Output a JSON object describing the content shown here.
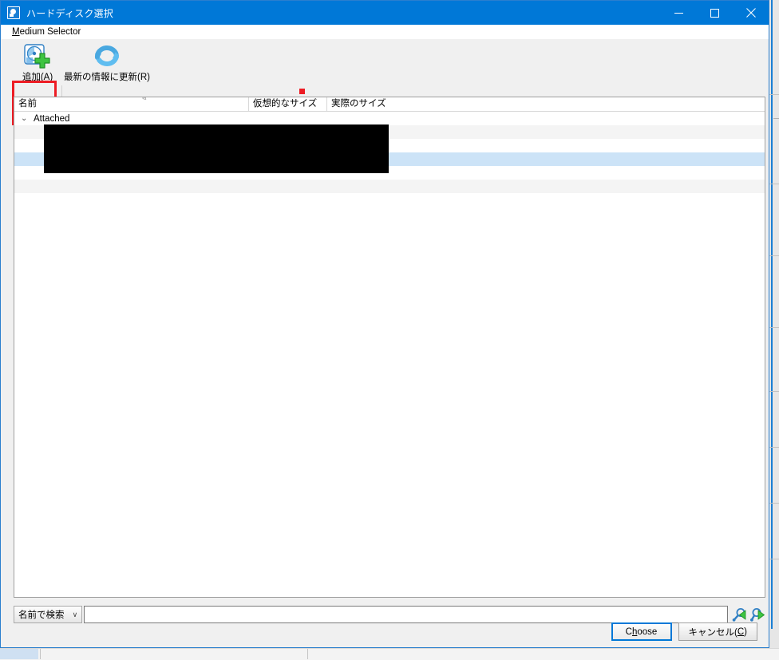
{
  "window": {
    "title": "ハードディスク選択",
    "icon": "harddisk-icon",
    "controls": {
      "minimize": "minimize-icon",
      "maximize": "maximize-icon",
      "close": "close-icon"
    }
  },
  "menubar": {
    "items": [
      {
        "label_prefix": "M",
        "label_rest": "edium Selector",
        "name": "medium-selector"
      }
    ]
  },
  "toolbar": {
    "add": {
      "label": "追加(A)",
      "icon": "harddisk-add-icon",
      "highlighted": true
    },
    "refresh": {
      "label": "最新の情報に更新(R)",
      "icon": "refresh-icon"
    },
    "highlight_color": "#ed1c24",
    "marker_color": "#ed1c24"
  },
  "listview": {
    "columns": [
      {
        "label": "名前",
        "name": "column-name",
        "sorted": true,
        "sort_indicator": "ⱏ"
      },
      {
        "label": "仮想的なサイズ",
        "name": "column-virtual-size"
      },
      {
        "label": "実際のサイズ",
        "name": "column-actual-size"
      }
    ],
    "tree": {
      "chevron": "⌄",
      "group_label": "Attached"
    },
    "rows": [
      {
        "style": "alt",
        "name": "table-row"
      },
      {
        "style": "white",
        "name": "table-row"
      },
      {
        "style": "sel",
        "name": "table-row",
        "selected": true
      },
      {
        "style": "white",
        "name": "table-row"
      },
      {
        "style": "alt",
        "name": "table-row"
      }
    ],
    "selection_color": "#cce3f7",
    "alt_row_color": "#f4f4f4"
  },
  "search": {
    "mode_label": "名前で検索",
    "chevron": "∨",
    "value": "",
    "placeholder": "",
    "prev_icon": "search-previous-icon",
    "next_icon": "search-next-icon"
  },
  "buttons": {
    "choose": {
      "prefix": "C",
      "accel": "h",
      "suffix": "oose",
      "name": "choose-button",
      "default": true
    },
    "cancel": {
      "prefix": "キャンセル(",
      "accel": "C",
      "suffix": ")",
      "name": "cancel-button"
    }
  }
}
